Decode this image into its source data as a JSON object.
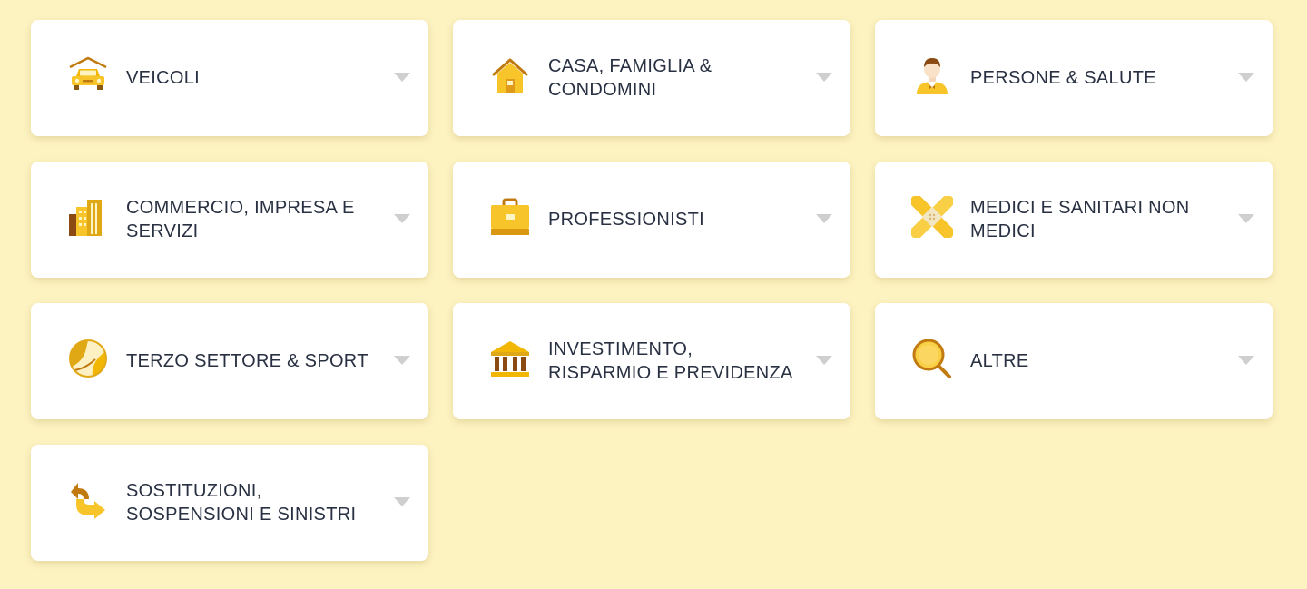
{
  "colors": {
    "background": "#fdf3c1",
    "card": "#ffffff",
    "text": "#283042",
    "accent": "#f2b705",
    "accent_dark": "#c07a10",
    "chevron": "#cfcfcf"
  },
  "categories": [
    {
      "label": "VEICOLI",
      "icon": "car-garage-icon"
    },
    {
      "label": "CASA, FAMIGLIA & CONDOMINI",
      "icon": "house-icon"
    },
    {
      "label": "PERSONE & SALUTE",
      "icon": "person-icon"
    },
    {
      "label": "COMMERCIO, IMPRESA E SERVIZI",
      "icon": "buildings-icon"
    },
    {
      "label": "PROFESSIONISTI",
      "icon": "briefcase-icon"
    },
    {
      "label": "MEDICI E SANITARI NON MEDICI",
      "icon": "bandage-icon"
    },
    {
      "label": "TERZO SETTORE & SPORT",
      "icon": "volleyball-icon"
    },
    {
      "label": "INVESTIMENTO, RISPARMIO E PREVIDENZA",
      "icon": "bank-icon"
    },
    {
      "label": "ALTRE",
      "icon": "magnifier-icon"
    },
    {
      "label": "SOSTITUZIONI, SOSPENSIONI E SINISTRI",
      "icon": "swap-arrows-icon"
    }
  ]
}
